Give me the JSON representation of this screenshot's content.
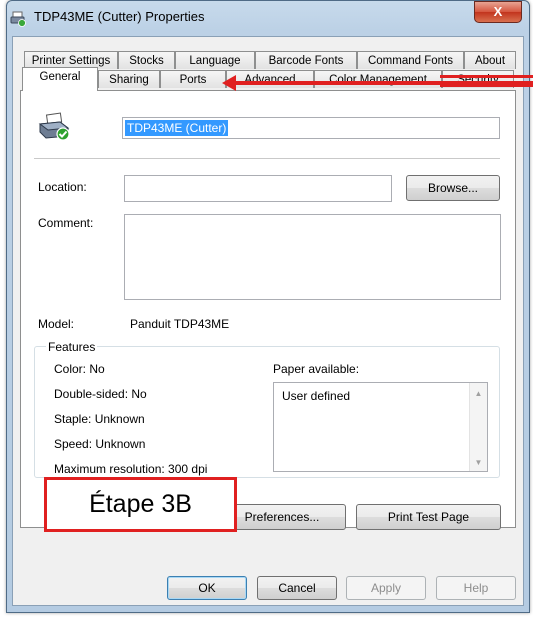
{
  "window": {
    "title": "TDP43ME (Cutter) Properties",
    "close_label": "X"
  },
  "tabs_back_row": [
    {
      "label": "Printer Settings"
    },
    {
      "label": "Stocks"
    },
    {
      "label": "Language"
    },
    {
      "label": "Barcode Fonts"
    },
    {
      "label": "Command Fonts"
    },
    {
      "label": "About"
    }
  ],
  "tabs_front_row": [
    {
      "label": "General",
      "active": true
    },
    {
      "label": "Sharing"
    },
    {
      "label": "Ports"
    },
    {
      "label": "Advanced"
    },
    {
      "label": "Color Management"
    },
    {
      "label": "Security"
    }
  ],
  "general": {
    "printer_name": "TDP43ME (Cutter)",
    "location_label": "Location:",
    "location_value": "",
    "browse_label": "Browse...",
    "comment_label": "Comment:",
    "comment_value": "",
    "model_label": "Model:",
    "model_value": "Panduit TDP43ME",
    "features_label": "Features",
    "features": [
      "Color: No",
      "Double-sided: No",
      "Staple: Unknown",
      "Speed: Unknown",
      "Maximum resolution: 300 dpi"
    ],
    "paper_available_label": "Paper available:",
    "paper_items": [
      "User defined"
    ],
    "preferences_label": "Preferences...",
    "print_test_label": "Print Test Page"
  },
  "dialog_buttons": {
    "ok": "OK",
    "cancel": "Cancel",
    "apply": "Apply",
    "help": "Help"
  },
  "annotation": {
    "callout_text": "Étape 3B",
    "color": "#e02020"
  }
}
